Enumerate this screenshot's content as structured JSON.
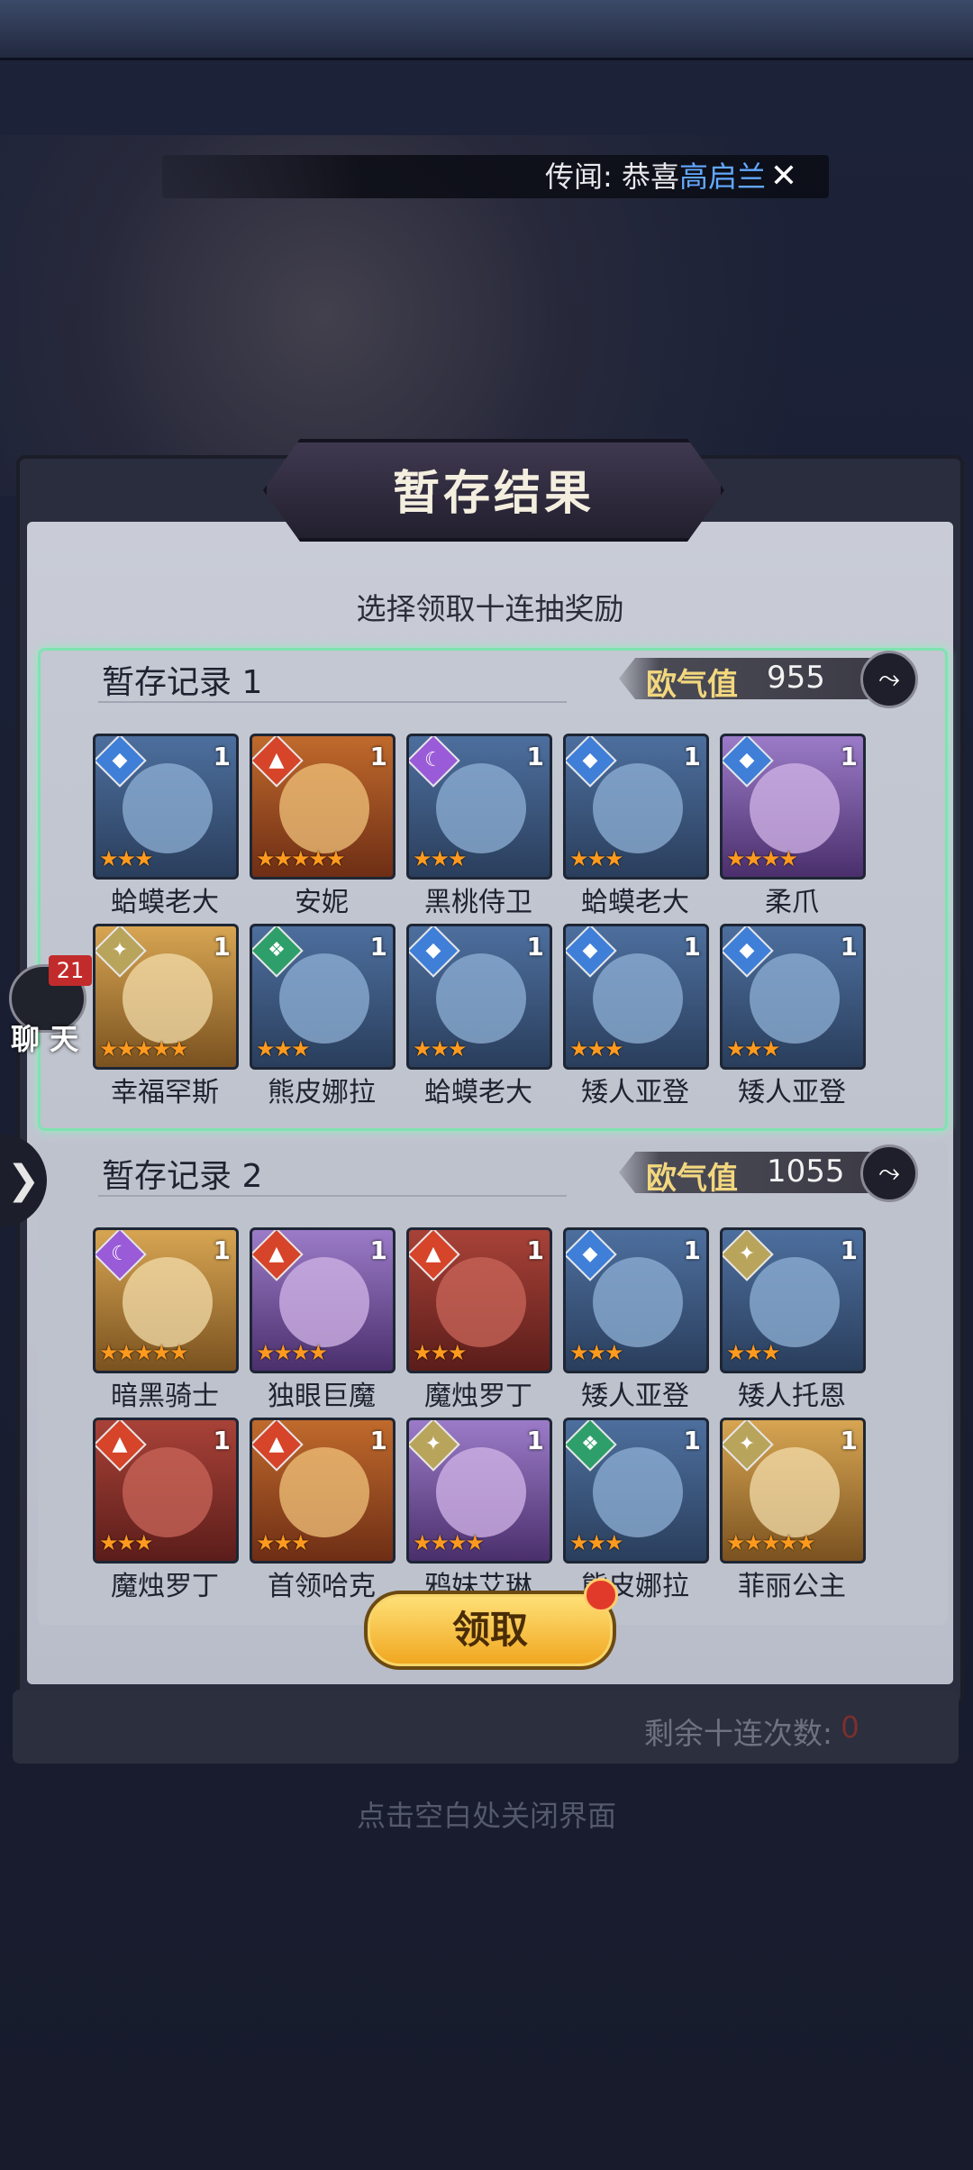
{
  "ticker": {
    "prefix": "传闻: 恭喜",
    "name": "高启兰"
  },
  "dialog": {
    "title": "暂存结果",
    "subtitle": "选择领取十连抽奖励",
    "records": [
      {
        "title": "暂存记录 1",
        "luck_label": "欧气值",
        "luck_value": "955",
        "cards": [
          {
            "name": "蛤蟆老大",
            "level": "1",
            "stars": 3,
            "element": "water",
            "bg": "blue"
          },
          {
            "name": "安妮",
            "level": "1",
            "stars": 5,
            "element": "fire",
            "bg": "orange"
          },
          {
            "name": "黑桃侍卫",
            "level": "1",
            "stars": 3,
            "element": "dark",
            "bg": "blue"
          },
          {
            "name": "蛤蟆老大",
            "level": "1",
            "stars": 3,
            "element": "water",
            "bg": "blue"
          },
          {
            "name": "柔爪",
            "level": "1",
            "stars": 4,
            "element": "water",
            "bg": "purple"
          },
          {
            "name": "幸福罕斯",
            "level": "1",
            "stars": 5,
            "element": "light",
            "bg": "gold"
          },
          {
            "name": "熊皮娜拉",
            "level": "1",
            "stars": 3,
            "element": "nature",
            "bg": "blue"
          },
          {
            "name": "蛤蟆老大",
            "level": "1",
            "stars": 3,
            "element": "water",
            "bg": "blue"
          },
          {
            "name": "矮人亚登",
            "level": "1",
            "stars": 3,
            "element": "water",
            "bg": "blue"
          },
          {
            "name": "矮人亚登",
            "level": "1",
            "stars": 3,
            "element": "water",
            "bg": "blue"
          }
        ]
      },
      {
        "title": "暂存记录 2",
        "luck_label": "欧气值",
        "luck_value": "1055",
        "cards": [
          {
            "name": "暗黑骑士",
            "level": "1",
            "stars": 5,
            "element": "dark",
            "bg": "gold"
          },
          {
            "name": "独眼巨魔",
            "level": "1",
            "stars": 4,
            "element": "fire",
            "bg": "purple"
          },
          {
            "name": "魔烛罗丁",
            "level": "1",
            "stars": 3,
            "element": "fire",
            "bg": "red"
          },
          {
            "name": "矮人亚登",
            "level": "1",
            "stars": 3,
            "element": "water",
            "bg": "blue"
          },
          {
            "name": "矮人托恩",
            "level": "1",
            "stars": 3,
            "element": "light",
            "bg": "blue"
          },
          {
            "name": "魔烛罗丁",
            "level": "1",
            "stars": 3,
            "element": "fire",
            "bg": "red"
          },
          {
            "name": "首领哈克",
            "level": "1",
            "stars": 3,
            "element": "fire",
            "bg": "orange"
          },
          {
            "name": "鸦妹艾琳",
            "level": "1",
            "stars": 4,
            "element": "light",
            "bg": "purple"
          },
          {
            "name": "熊皮娜拉",
            "level": "1",
            "stars": 3,
            "element": "nature",
            "bg": "blue"
          },
          {
            "name": "菲丽公主",
            "level": "1",
            "stars": 5,
            "element": "light",
            "bg": "gold"
          }
        ]
      }
    ],
    "claim_label": "领取"
  },
  "remaining": {
    "label": "剩余十连次数:",
    "value": "0"
  },
  "close_hint": "点击空白处关闭界面",
  "chat": {
    "badge": "21",
    "label": "聊 天"
  },
  "side_arrow": "❯",
  "share_icon": "⤳"
}
